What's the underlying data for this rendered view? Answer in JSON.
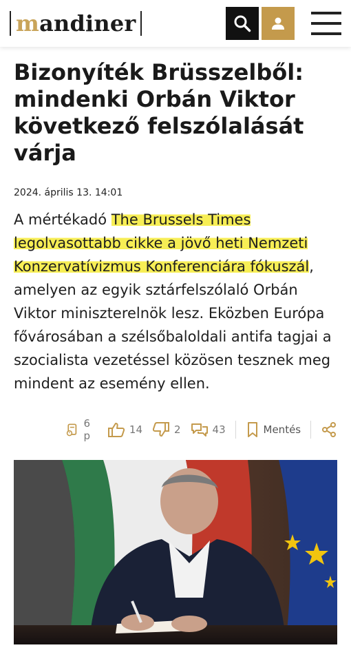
{
  "site": {
    "logo": "mandiner",
    "logo_first_letter": "m",
    "logo_rest": "andiner"
  },
  "header": {
    "search_icon": "search-icon",
    "user_icon": "user-icon",
    "menu_icon": "hamburger-menu-icon"
  },
  "article": {
    "title": "Bizonyíték Brüsszelből: mindenki Orbán Viktor következő felszólalását várja",
    "date": "2024. április 13. 14:01",
    "lead": {
      "part1": "A mértékadó ",
      "highlight1": "The Brussels Times legolvasottabb cikke a jövő heti Nemzeti Konzervatívizmus Konferenciára fókuszál",
      "part2": ", amelyen az egyik sztárfelszólaló Orbán Viktor miniszterelnök lesz. Eközben Európa fővárosában a szélsőbaloldali antifa tagjai a szocialista vezetéssel közösen tesznek meg mindent az esemény ellen."
    }
  },
  "actions": {
    "read_time": "6 p",
    "likes": "14",
    "dislikes": "2",
    "comments": "43",
    "save_label": "Mentés"
  },
  "colors": {
    "brand_gold": "#c49a4c",
    "highlight": "#f7ee55",
    "dark": "#111111"
  }
}
